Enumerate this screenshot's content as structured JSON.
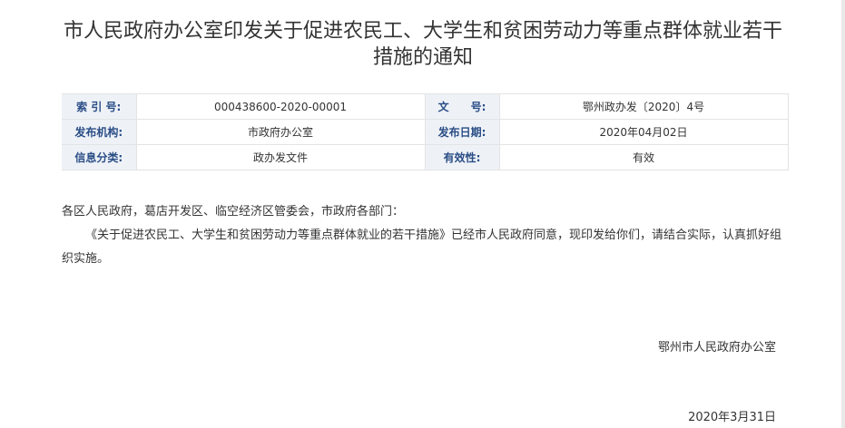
{
  "title": "市人民政府办公室印发关于促进农民工、大学生和贫困劳动力等重点群体就业若干措施的通知",
  "meta": [
    {
      "k1": "索 引 号:",
      "v1": "000438600-2020-00001",
      "k2": "文　　号:",
      "v2": "鄂州政办发〔2020〕4号"
    },
    {
      "k1": "发布机构:",
      "v1": "市政府办公室",
      "k2": "发布日期:",
      "v2": "2020年04月02日"
    },
    {
      "k1": "信息分类:",
      "v1": "政办发文件",
      "k2": "有效性:",
      "v2": "有效"
    }
  ],
  "body": {
    "salutation": "各区人民政府，葛店开发区、临空经济区管委会，市政府各部门：",
    "paragraph": "《关于促进农民工、大学生和贫困劳动力等重点群体就业的若干措施》已经市人民政府同意，现印发给你们，请结合实际，认真抓好组织实施。"
  },
  "signature": "鄂州市人民政府办公室",
  "date": "2020年3月31日"
}
